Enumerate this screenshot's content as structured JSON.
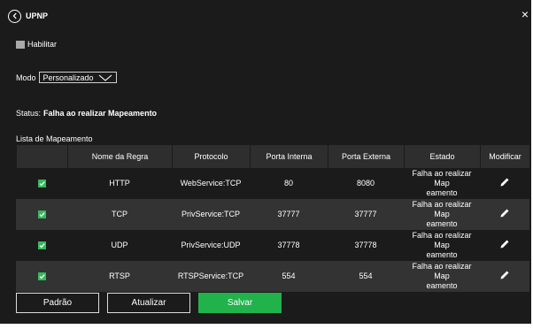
{
  "header": {
    "title": "UPNP"
  },
  "enable": {
    "label": "Habilitar"
  },
  "mode": {
    "label": "Modo",
    "value": "Personalizado"
  },
  "status": {
    "label": "Status:",
    "value": "Falha ao realizar Mapeamento"
  },
  "list": {
    "title": "Lista de Mapeamento"
  },
  "table": {
    "headers": [
      "Nome da Regra",
      "Protocolo",
      "Porta Interna",
      "Porta Externa",
      "Estado",
      "Modificar"
    ],
    "rows": [
      {
        "name": "HTTP",
        "protocol": "WebService:TCP",
        "internal": "80",
        "external": "8080",
        "state_line1": "Falha ao realizar Map",
        "state_line2": "eamento"
      },
      {
        "name": "TCP",
        "protocol": "PrivService:TCP",
        "internal": "37777",
        "external": "37777",
        "state_line1": "Falha ao realizar Map",
        "state_line2": "eamento"
      },
      {
        "name": "UDP",
        "protocol": "PrivService:UDP",
        "internal": "37778",
        "external": "37778",
        "state_line1": "Falha ao realizar Map",
        "state_line2": "eamento"
      },
      {
        "name": "RTSP",
        "protocol": "RTSPService:TCP",
        "internal": "554",
        "external": "554",
        "state_line1": "Falha ao realizar Map",
        "state_line2": "eamento"
      }
    ]
  },
  "buttons": {
    "default": "Padrão",
    "refresh": "Atualizar",
    "save": "Salvar"
  },
  "colors": {
    "background": "#1b1b1b",
    "accent": "#22b24c",
    "header_row": "#2e2e2e"
  }
}
